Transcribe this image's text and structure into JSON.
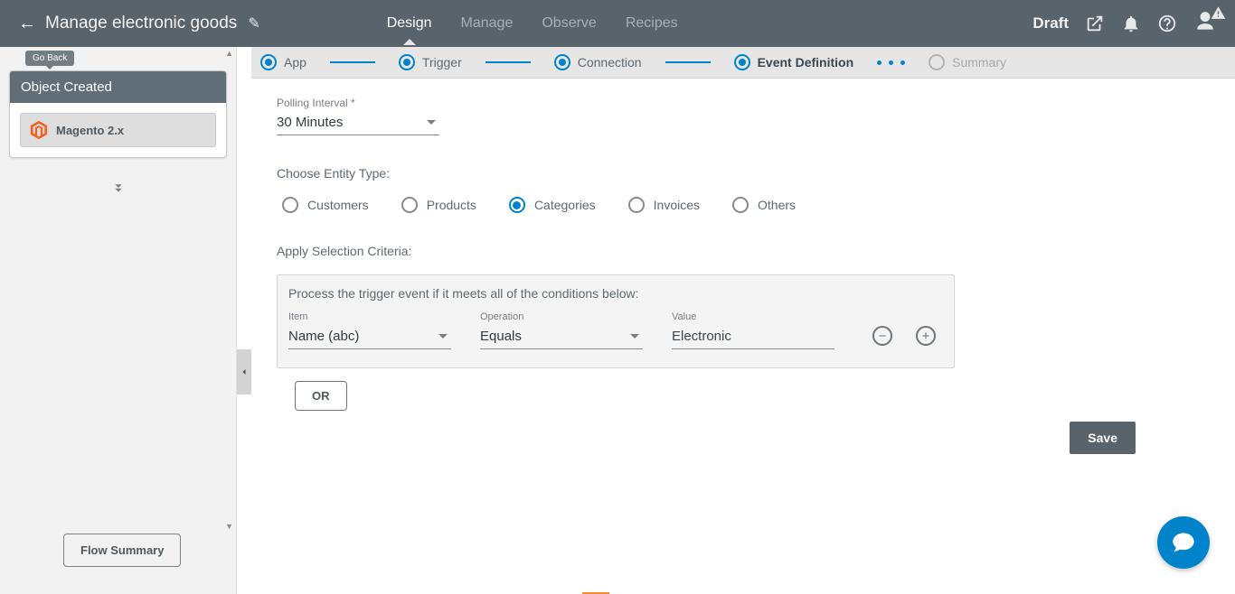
{
  "header": {
    "title": "Manage electronic goods",
    "tabs": [
      "Design",
      "Manage",
      "Observe",
      "Recipes"
    ],
    "active_tab": 0,
    "status": "Draft"
  },
  "stepper": {
    "steps": [
      "App",
      "Trigger",
      "Connection",
      "Event Definition",
      "Summary"
    ],
    "active_index": 3
  },
  "sidebar": {
    "go_back_label": "Go Back",
    "card_title": "Object Created",
    "app_name": "Magento 2.x",
    "flow_summary_btn": "Flow Summary"
  },
  "form": {
    "polling_label": "Polling Interval *",
    "polling_value": "30 Minutes",
    "entity_label": "Choose Entity Type:",
    "entity_options": [
      "Customers",
      "Products",
      "Categories",
      "Invoices",
      "Others"
    ],
    "entity_selected": 2,
    "criteria_label": "Apply Selection Criteria:",
    "criteria_help": "Process the trigger event if it meets all of the conditions below:",
    "criteria_row": {
      "item_label": "Item",
      "item_value": "Name  (abc)",
      "op_label": "Operation",
      "op_value": "Equals",
      "value_label": "Value",
      "value_value": "Electronic"
    },
    "or_btn": "OR",
    "save_btn": "Save"
  }
}
